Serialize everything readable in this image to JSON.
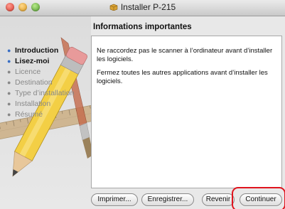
{
  "window": {
    "title": "Installer P-215"
  },
  "sidebar": {
    "steps": [
      {
        "label": "Introduction",
        "state": "done"
      },
      {
        "label": "Lisez-moi",
        "state": "current"
      },
      {
        "label": "Licence",
        "state": "pending"
      },
      {
        "label": "Destination",
        "state": "pending"
      },
      {
        "label": "Type d’installation",
        "state": "pending"
      },
      {
        "label": "Installation",
        "state": "pending"
      },
      {
        "label": "Résumé",
        "state": "pending"
      }
    ]
  },
  "main": {
    "heading": "Informations importantes",
    "paragraphs": [
      "Ne raccordez pas le scanner à l’ordinateur avant d’installer les logiciels.",
      "Fermez toutes les autres applications avant d’installer les logiciels."
    ]
  },
  "buttons": {
    "print_label": "Imprimer...",
    "save_label": "Enregistrer...",
    "back_label": "Revenir",
    "continue_label": "Continuer"
  },
  "colors": {
    "highlight": "#e0141e",
    "accent": "#3a6fc4"
  }
}
